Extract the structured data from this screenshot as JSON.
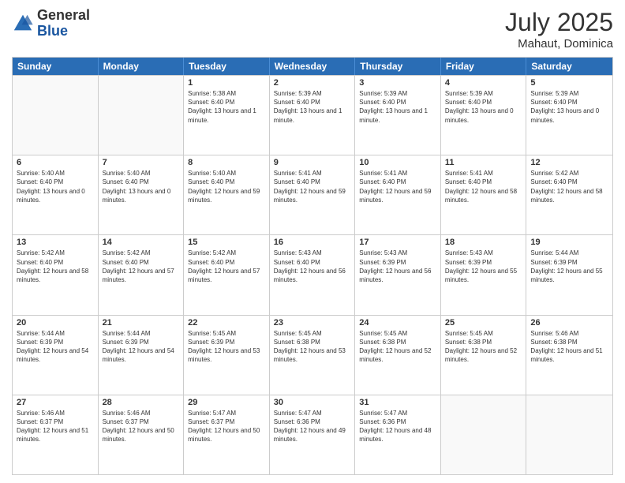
{
  "logo": {
    "general": "General",
    "blue": "Blue"
  },
  "title": "July 2025",
  "location": "Mahaut, Dominica",
  "days_of_week": [
    "Sunday",
    "Monday",
    "Tuesday",
    "Wednesday",
    "Thursday",
    "Friday",
    "Saturday"
  ],
  "weeks": [
    [
      {
        "day": "",
        "info": ""
      },
      {
        "day": "",
        "info": ""
      },
      {
        "day": "1",
        "info": "Sunrise: 5:38 AM\nSunset: 6:40 PM\nDaylight: 13 hours and 1 minute."
      },
      {
        "day": "2",
        "info": "Sunrise: 5:39 AM\nSunset: 6:40 PM\nDaylight: 13 hours and 1 minute."
      },
      {
        "day": "3",
        "info": "Sunrise: 5:39 AM\nSunset: 6:40 PM\nDaylight: 13 hours and 1 minute."
      },
      {
        "day": "4",
        "info": "Sunrise: 5:39 AM\nSunset: 6:40 PM\nDaylight: 13 hours and 0 minutes."
      },
      {
        "day": "5",
        "info": "Sunrise: 5:39 AM\nSunset: 6:40 PM\nDaylight: 13 hours and 0 minutes."
      }
    ],
    [
      {
        "day": "6",
        "info": "Sunrise: 5:40 AM\nSunset: 6:40 PM\nDaylight: 13 hours and 0 minutes."
      },
      {
        "day": "7",
        "info": "Sunrise: 5:40 AM\nSunset: 6:40 PM\nDaylight: 13 hours and 0 minutes."
      },
      {
        "day": "8",
        "info": "Sunrise: 5:40 AM\nSunset: 6:40 PM\nDaylight: 12 hours and 59 minutes."
      },
      {
        "day": "9",
        "info": "Sunrise: 5:41 AM\nSunset: 6:40 PM\nDaylight: 12 hours and 59 minutes."
      },
      {
        "day": "10",
        "info": "Sunrise: 5:41 AM\nSunset: 6:40 PM\nDaylight: 12 hours and 59 minutes."
      },
      {
        "day": "11",
        "info": "Sunrise: 5:41 AM\nSunset: 6:40 PM\nDaylight: 12 hours and 58 minutes."
      },
      {
        "day": "12",
        "info": "Sunrise: 5:42 AM\nSunset: 6:40 PM\nDaylight: 12 hours and 58 minutes."
      }
    ],
    [
      {
        "day": "13",
        "info": "Sunrise: 5:42 AM\nSunset: 6:40 PM\nDaylight: 12 hours and 58 minutes."
      },
      {
        "day": "14",
        "info": "Sunrise: 5:42 AM\nSunset: 6:40 PM\nDaylight: 12 hours and 57 minutes."
      },
      {
        "day": "15",
        "info": "Sunrise: 5:42 AM\nSunset: 6:40 PM\nDaylight: 12 hours and 57 minutes."
      },
      {
        "day": "16",
        "info": "Sunrise: 5:43 AM\nSunset: 6:40 PM\nDaylight: 12 hours and 56 minutes."
      },
      {
        "day": "17",
        "info": "Sunrise: 5:43 AM\nSunset: 6:39 PM\nDaylight: 12 hours and 56 minutes."
      },
      {
        "day": "18",
        "info": "Sunrise: 5:43 AM\nSunset: 6:39 PM\nDaylight: 12 hours and 55 minutes."
      },
      {
        "day": "19",
        "info": "Sunrise: 5:44 AM\nSunset: 6:39 PM\nDaylight: 12 hours and 55 minutes."
      }
    ],
    [
      {
        "day": "20",
        "info": "Sunrise: 5:44 AM\nSunset: 6:39 PM\nDaylight: 12 hours and 54 minutes."
      },
      {
        "day": "21",
        "info": "Sunrise: 5:44 AM\nSunset: 6:39 PM\nDaylight: 12 hours and 54 minutes."
      },
      {
        "day": "22",
        "info": "Sunrise: 5:45 AM\nSunset: 6:39 PM\nDaylight: 12 hours and 53 minutes."
      },
      {
        "day": "23",
        "info": "Sunrise: 5:45 AM\nSunset: 6:38 PM\nDaylight: 12 hours and 53 minutes."
      },
      {
        "day": "24",
        "info": "Sunrise: 5:45 AM\nSunset: 6:38 PM\nDaylight: 12 hours and 52 minutes."
      },
      {
        "day": "25",
        "info": "Sunrise: 5:45 AM\nSunset: 6:38 PM\nDaylight: 12 hours and 52 minutes."
      },
      {
        "day": "26",
        "info": "Sunrise: 5:46 AM\nSunset: 6:38 PM\nDaylight: 12 hours and 51 minutes."
      }
    ],
    [
      {
        "day": "27",
        "info": "Sunrise: 5:46 AM\nSunset: 6:37 PM\nDaylight: 12 hours and 51 minutes."
      },
      {
        "day": "28",
        "info": "Sunrise: 5:46 AM\nSunset: 6:37 PM\nDaylight: 12 hours and 50 minutes."
      },
      {
        "day": "29",
        "info": "Sunrise: 5:47 AM\nSunset: 6:37 PM\nDaylight: 12 hours and 50 minutes."
      },
      {
        "day": "30",
        "info": "Sunrise: 5:47 AM\nSunset: 6:36 PM\nDaylight: 12 hours and 49 minutes."
      },
      {
        "day": "31",
        "info": "Sunrise: 5:47 AM\nSunset: 6:36 PM\nDaylight: 12 hours and 48 minutes."
      },
      {
        "day": "",
        "info": ""
      },
      {
        "day": "",
        "info": ""
      }
    ]
  ]
}
